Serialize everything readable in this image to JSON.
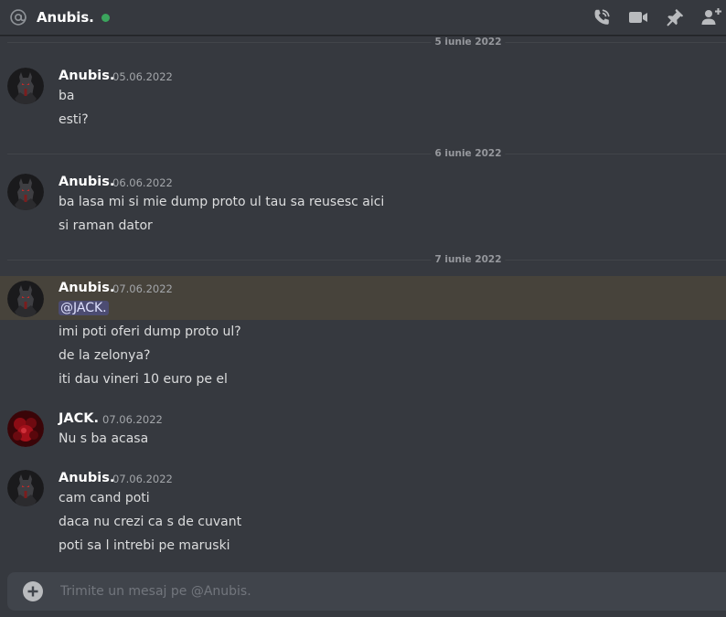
{
  "header": {
    "title": "Anubis.",
    "status": "online",
    "status_color": "#3ba55d",
    "icons": [
      "at-icon",
      "phone-call-icon",
      "video-call-icon",
      "pin-icon",
      "add-friend-icon"
    ]
  },
  "dividers": [
    {
      "label": "5 iunie 2022"
    },
    {
      "label": "6 iunie 2022"
    },
    {
      "label": "7 iunie 2022"
    }
  ],
  "messages": [
    {
      "author": "Anubis.",
      "timestamp": "05.06.2022",
      "lines": [
        "ba",
        "esti?"
      ]
    },
    {
      "author": "Anubis.",
      "timestamp": "06.06.2022",
      "lines": [
        "ba lasa mi si mie dump proto ul tau sa reusesc aici",
        "si raman dator"
      ]
    },
    {
      "author": "Anubis.",
      "timestamp": "07.06.2022",
      "mention": "@JACK.",
      "lines": [
        "imi poti oferi dump proto ul?",
        "de la zelonya?",
        "iti dau vineri 10 euro pe el"
      ]
    },
    {
      "author": "JACK.",
      "timestamp": "07.06.2022",
      "lines": [
        "Nu s ba acasa"
      ]
    },
    {
      "author": "Anubis.",
      "timestamp": "07.06.2022",
      "lines": [
        "cam cand poti",
        "daca nu crezi ca s de cuvant",
        "poti sa l intrebi pe maruski"
      ]
    }
  ],
  "composer": {
    "placeholder": "Trimite un mesaj pe @Anubis."
  },
  "colors": {
    "background": "#36393f",
    "mention_highlight": "#47433b",
    "composer_bg": "#40444b"
  }
}
